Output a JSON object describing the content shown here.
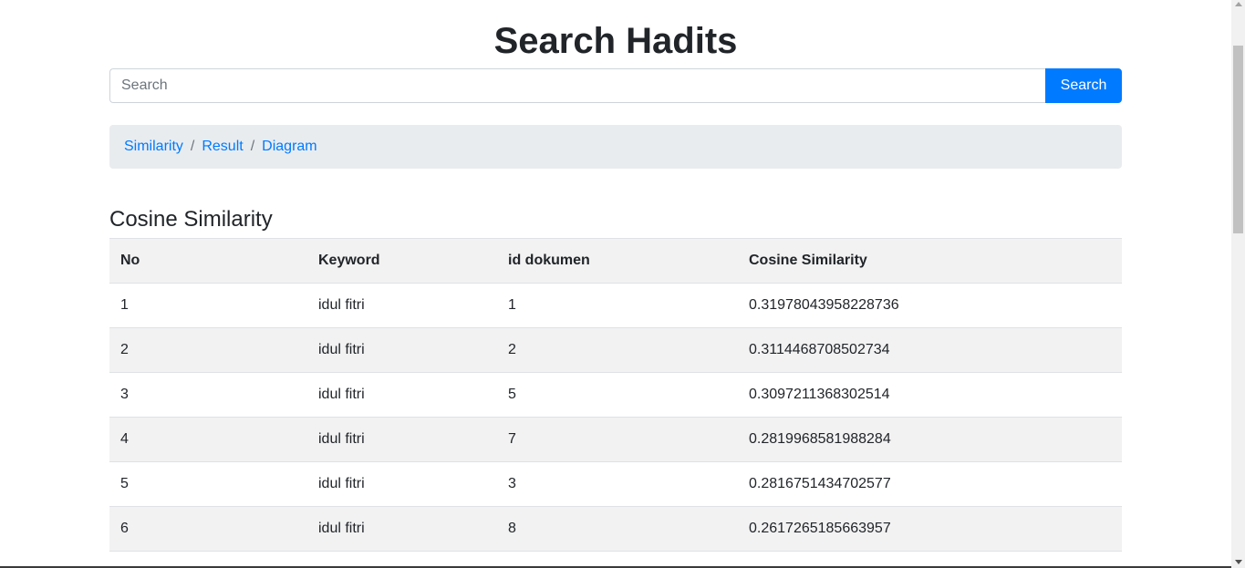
{
  "header": {
    "title": "Search Hadits"
  },
  "search": {
    "placeholder": "Search",
    "value": "",
    "button_label": "Search"
  },
  "breadcrumb": {
    "items": [
      {
        "label": "Similarity"
      },
      {
        "label": "Result"
      },
      {
        "label": "Diagram"
      }
    ],
    "separator": "/"
  },
  "section": {
    "title": "Cosine Similarity"
  },
  "table": {
    "columns": [
      "No",
      "Keyword",
      "id dokumen",
      "Cosine Similarity"
    ],
    "rows": [
      [
        "1",
        "idul fitri",
        "1",
        "0.31978043958228736"
      ],
      [
        "2",
        "idul fitri",
        "2",
        "0.3114468708502734"
      ],
      [
        "3",
        "idul fitri",
        "5",
        "0.3097211368302514"
      ],
      [
        "4",
        "idul fitri",
        "7",
        "0.2819968581988284"
      ],
      [
        "5",
        "idul fitri",
        "3",
        "0.2816751434702577"
      ],
      [
        "6",
        "idul fitri",
        "8",
        "0.2617265185663957"
      ]
    ]
  },
  "colors": {
    "primary": "#007bff",
    "breadcrumb_bg": "#e9ecef",
    "stripe": "#f2f2f2",
    "text": "#212529"
  }
}
